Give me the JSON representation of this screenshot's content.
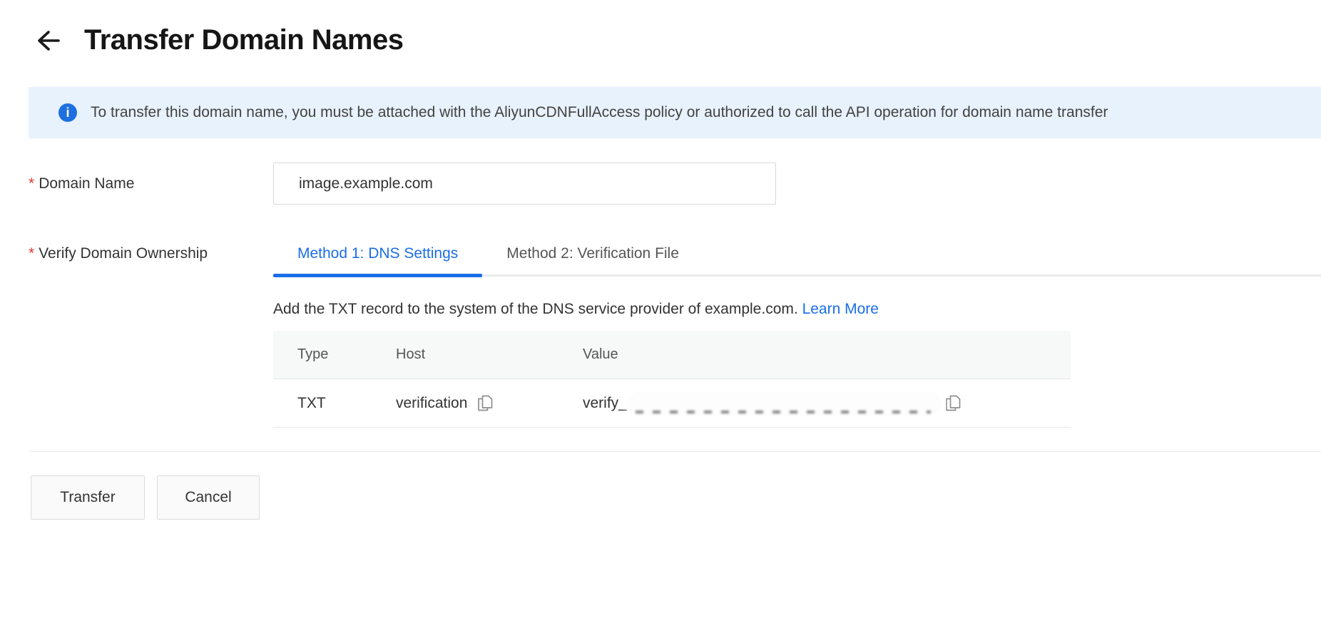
{
  "page": {
    "title": "Transfer Domain Names"
  },
  "banner": {
    "info_icon": "i",
    "text": "To transfer this domain name, you must be attached with the AliyunCDNFullAccess policy or authorized to call the API operation for domain name transfer"
  },
  "form": {
    "required_mark": "*",
    "domain_name": {
      "label": "Domain Name",
      "value": "image.example.com"
    },
    "verify_ownership": {
      "label": "Verify Domain Ownership",
      "tabs": [
        {
          "label": "Method 1: DNS Settings",
          "active": true
        },
        {
          "label": "Method 2: Verification File",
          "active": false
        }
      ],
      "description": "Add the TXT record to the system of the DNS service provider of example.com.",
      "learn_more_label": "Learn More",
      "table": {
        "headers": [
          "Type",
          "Host",
          "Value"
        ],
        "row": {
          "type": "TXT",
          "host": "verification",
          "value_prefix": "verify_",
          "value_redacted": true
        }
      }
    }
  },
  "footer": {
    "transfer_label": "Transfer",
    "cancel_label": "Cancel"
  },
  "colors": {
    "accent": "#1a6ee8",
    "banner_bg": "#e7f2fc",
    "required": "#e63633"
  }
}
